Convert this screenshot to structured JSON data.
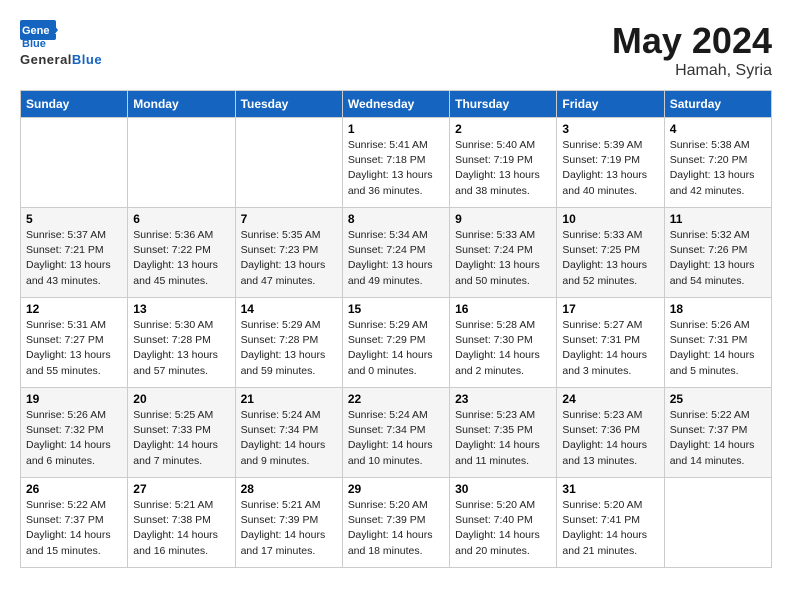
{
  "header": {
    "logo_line1": "General",
    "logo_line2": "Blue",
    "title": "May 2024",
    "location": "Hamah, Syria"
  },
  "weekdays": [
    "Sunday",
    "Monday",
    "Tuesday",
    "Wednesday",
    "Thursday",
    "Friday",
    "Saturday"
  ],
  "weeks": [
    [
      {
        "day": "",
        "info": ""
      },
      {
        "day": "",
        "info": ""
      },
      {
        "day": "",
        "info": ""
      },
      {
        "day": "1",
        "info": "Sunrise: 5:41 AM\nSunset: 7:18 PM\nDaylight: 13 hours\nand 36 minutes."
      },
      {
        "day": "2",
        "info": "Sunrise: 5:40 AM\nSunset: 7:19 PM\nDaylight: 13 hours\nand 38 minutes."
      },
      {
        "day": "3",
        "info": "Sunrise: 5:39 AM\nSunset: 7:19 PM\nDaylight: 13 hours\nand 40 minutes."
      },
      {
        "day": "4",
        "info": "Sunrise: 5:38 AM\nSunset: 7:20 PM\nDaylight: 13 hours\nand 42 minutes."
      }
    ],
    [
      {
        "day": "5",
        "info": "Sunrise: 5:37 AM\nSunset: 7:21 PM\nDaylight: 13 hours\nand 43 minutes."
      },
      {
        "day": "6",
        "info": "Sunrise: 5:36 AM\nSunset: 7:22 PM\nDaylight: 13 hours\nand 45 minutes."
      },
      {
        "day": "7",
        "info": "Sunrise: 5:35 AM\nSunset: 7:23 PM\nDaylight: 13 hours\nand 47 minutes."
      },
      {
        "day": "8",
        "info": "Sunrise: 5:34 AM\nSunset: 7:24 PM\nDaylight: 13 hours\nand 49 minutes."
      },
      {
        "day": "9",
        "info": "Sunrise: 5:33 AM\nSunset: 7:24 PM\nDaylight: 13 hours\nand 50 minutes."
      },
      {
        "day": "10",
        "info": "Sunrise: 5:33 AM\nSunset: 7:25 PM\nDaylight: 13 hours\nand 52 minutes."
      },
      {
        "day": "11",
        "info": "Sunrise: 5:32 AM\nSunset: 7:26 PM\nDaylight: 13 hours\nand 54 minutes."
      }
    ],
    [
      {
        "day": "12",
        "info": "Sunrise: 5:31 AM\nSunset: 7:27 PM\nDaylight: 13 hours\nand 55 minutes."
      },
      {
        "day": "13",
        "info": "Sunrise: 5:30 AM\nSunset: 7:28 PM\nDaylight: 13 hours\nand 57 minutes."
      },
      {
        "day": "14",
        "info": "Sunrise: 5:29 AM\nSunset: 7:28 PM\nDaylight: 13 hours\nand 59 minutes."
      },
      {
        "day": "15",
        "info": "Sunrise: 5:29 AM\nSunset: 7:29 PM\nDaylight: 14 hours\nand 0 minutes."
      },
      {
        "day": "16",
        "info": "Sunrise: 5:28 AM\nSunset: 7:30 PM\nDaylight: 14 hours\nand 2 minutes."
      },
      {
        "day": "17",
        "info": "Sunrise: 5:27 AM\nSunset: 7:31 PM\nDaylight: 14 hours\nand 3 minutes."
      },
      {
        "day": "18",
        "info": "Sunrise: 5:26 AM\nSunset: 7:31 PM\nDaylight: 14 hours\nand 5 minutes."
      }
    ],
    [
      {
        "day": "19",
        "info": "Sunrise: 5:26 AM\nSunset: 7:32 PM\nDaylight: 14 hours\nand 6 minutes."
      },
      {
        "day": "20",
        "info": "Sunrise: 5:25 AM\nSunset: 7:33 PM\nDaylight: 14 hours\nand 7 minutes."
      },
      {
        "day": "21",
        "info": "Sunrise: 5:24 AM\nSunset: 7:34 PM\nDaylight: 14 hours\nand 9 minutes."
      },
      {
        "day": "22",
        "info": "Sunrise: 5:24 AM\nSunset: 7:34 PM\nDaylight: 14 hours\nand 10 minutes."
      },
      {
        "day": "23",
        "info": "Sunrise: 5:23 AM\nSunset: 7:35 PM\nDaylight: 14 hours\nand 11 minutes."
      },
      {
        "day": "24",
        "info": "Sunrise: 5:23 AM\nSunset: 7:36 PM\nDaylight: 14 hours\nand 13 minutes."
      },
      {
        "day": "25",
        "info": "Sunrise: 5:22 AM\nSunset: 7:37 PM\nDaylight: 14 hours\nand 14 minutes."
      }
    ],
    [
      {
        "day": "26",
        "info": "Sunrise: 5:22 AM\nSunset: 7:37 PM\nDaylight: 14 hours\nand 15 minutes."
      },
      {
        "day": "27",
        "info": "Sunrise: 5:21 AM\nSunset: 7:38 PM\nDaylight: 14 hours\nand 16 minutes."
      },
      {
        "day": "28",
        "info": "Sunrise: 5:21 AM\nSunset: 7:39 PM\nDaylight: 14 hours\nand 17 minutes."
      },
      {
        "day": "29",
        "info": "Sunrise: 5:20 AM\nSunset: 7:39 PM\nDaylight: 14 hours\nand 18 minutes."
      },
      {
        "day": "30",
        "info": "Sunrise: 5:20 AM\nSunset: 7:40 PM\nDaylight: 14 hours\nand 20 minutes."
      },
      {
        "day": "31",
        "info": "Sunrise: 5:20 AM\nSunset: 7:41 PM\nDaylight: 14 hours\nand 21 minutes."
      },
      {
        "day": "",
        "info": ""
      }
    ]
  ]
}
